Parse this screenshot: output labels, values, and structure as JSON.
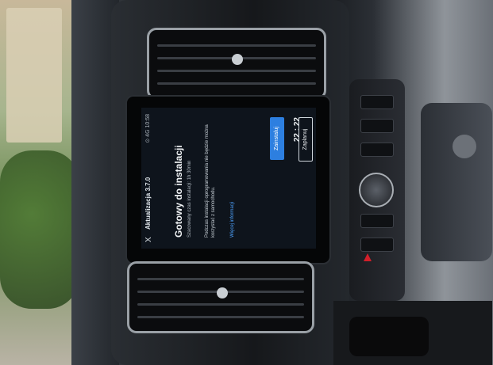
{
  "screen": {
    "status_text": "⊙ 4G  10:58",
    "close_glyph": "X",
    "app_title": "Aktualizacja 3.7.0",
    "heading": "Gotowy do instalacji",
    "subtitle": "Szacowany czas instalacji: 1h 30min",
    "note": "Podczas instalacji oprogramowania nie będzie można korzystać z samochodu.",
    "link": "Więcej informacji",
    "install_button": "Zainstaluj",
    "time": "22 : 22",
    "later_button": "Zaplanuj"
  },
  "colors": {
    "screen_bg": "#0e141c",
    "primary_button": "#2d7fe0",
    "hazard": "#d21f2a"
  }
}
